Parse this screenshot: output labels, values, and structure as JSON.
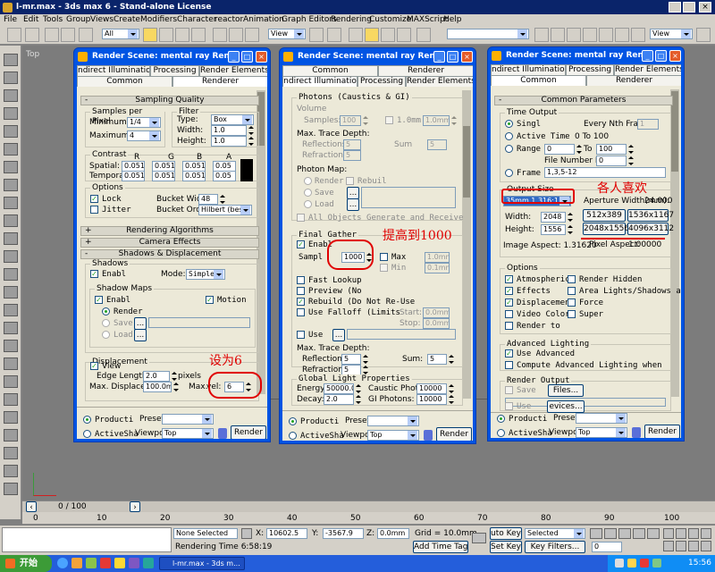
{
  "app": {
    "title": "l-mr.max - 3ds max 6 - Stand-alone License",
    "menu": [
      "File",
      "Edit",
      "Tools",
      "Group",
      "Views",
      "Create",
      "Modifiers",
      "Character",
      "reactor",
      "Animation",
      "Graph Editors",
      "Rendering",
      "Customize",
      "MAXScript",
      "Help"
    ],
    "toolbar": {
      "selection_filter": "All",
      "ref_coord": "View",
      "named_sel": "View"
    },
    "viewport_label": "Top"
  },
  "dialog1": {
    "title": "Render Scene: mental ray Ren...",
    "tabs_row1": [
      "ndirect Illumination",
      "Processing",
      "Render Elements"
    ],
    "tabs_row2": [
      "Common",
      "Renderer"
    ],
    "sampling": {
      "rollout": "Sampling Quality",
      "spp_group": "Samples per Pixel",
      "minimum_label": "Minimum:",
      "minimum": "1/4",
      "maximum_label": "Maximum:",
      "maximum": "4",
      "filter_group": "Filter",
      "type_label": "Type:",
      "type": "Box",
      "width_label": "Width:",
      "width": "1.0",
      "height_label": "Height:",
      "height": "1.0",
      "contrast_group": "Contrast",
      "r": "R",
      "g": "G",
      "b": "B",
      "a": "A",
      "spatial_label": "Spatial:",
      "spatial": [
        "0.051",
        "0.051",
        "0.051",
        "0.05"
      ],
      "temporal_label": "Temporal:",
      "temporal": [
        "0.051",
        "0.051",
        "0.051",
        "0.05"
      ],
      "options_group": "Options",
      "lock": "Lock",
      "jitter": "Jitter",
      "bucket_width_label": "Bucket Width:",
      "bucket_width": "48",
      "bucket_order_label": "Bucket Order:",
      "bucket_order": "Hilbert (best)"
    },
    "rollouts": [
      "Rendering Algorithms",
      "Camera Effects",
      "Shadows & Displacement"
    ],
    "shadows": {
      "group": "Shadows",
      "enable": "Enabl",
      "mode_label": "Mode:",
      "mode": "Simple"
    },
    "shadow_maps": {
      "group": "Shadow Maps",
      "enable": "Enabl",
      "motion": "Motion",
      "render": "Render",
      "save": "Save",
      "load": "Load",
      "browse": "..."
    },
    "displacement": {
      "group": "Displacement",
      "view": "View",
      "edge_length_label": "Edge Length:",
      "edge_length": "2.0",
      "edge_unit": "pixels",
      "max_displace_label": "Max. Displace:",
      "max_displace": "100.0mm",
      "max_level_label": "Max.",
      "max_level_tail": "vel:",
      "max_level": "6"
    },
    "bottom": {
      "production": "Producti",
      "activeshade": "ActiveSha",
      "preset_label": "Preset:",
      "preset": "",
      "viewport_label": "Viewport:",
      "viewport": "Top",
      "render": "Render"
    },
    "annotation": "设为6"
  },
  "dialog2": {
    "title": "Render Scene: mental ray Ren...",
    "tabs_row1": [
      "Common",
      "Renderer"
    ],
    "tabs_row2": [
      "ndirect Illuminatio",
      "Processing",
      "Render Elements"
    ],
    "photons": {
      "group": "Photons (Caustics & GI)",
      "volume": "Volume",
      "samples_label": "Samples:",
      "samples": "100",
      "radius_label": "Radius",
      "radius": "1.0mm",
      "max_trace_label": "Max. Trace Depth:",
      "reflections_label": "Reflections:",
      "reflections": "5",
      "refractions_label": "Refractions:",
      "refractions": "5",
      "sum_label": "Sum",
      "sum": "5",
      "photon_map_label": "Photon Map:",
      "render": "Render",
      "rebuild": "Rebuil",
      "save": "Save",
      "load": "Load",
      "browse": "...",
      "all_objects": "All Objects Generate and Receive"
    },
    "final_gather": {
      "group": "Final Gather",
      "enable": "Enabl",
      "samples_label": "Sampl",
      "samples": "1000",
      "max_label": "Max",
      "max": "1.0mm",
      "min_label": "Min",
      "min": "0.1mm",
      "fast_lookup": "Fast Lookup",
      "preview": "Preview (No",
      "rebuild": "Rebuild (Do Not Re-Use",
      "use_falloff": "Use Falloff (Limits",
      "start_label": "Start:",
      "start": "0.0mm",
      "stop_label": "Stop:",
      "stop": "0.0mm",
      "use": "Use",
      "browse": "...",
      "max_trace_label": "Max. Trace Depth:",
      "reflections_label": "Reflections:",
      "reflections": "5",
      "refractions_label": "Refractions:",
      "refractions": "5",
      "sum_label": "Sum:",
      "sum": "5"
    },
    "global_light": {
      "group": "Global Light Properties",
      "energy_label": "Energy:",
      "energy": "50000.0",
      "decay_label": "Decay:",
      "decay": "2.0",
      "caustic_label": "Caustic Photons:",
      "caustic": "10000",
      "gi_label": "GI Photons:",
      "gi": "10000"
    },
    "bottom": {
      "production": "Producti",
      "activeshade": "ActiveSha",
      "preset_label": "Preset:",
      "preset": "",
      "viewport_label": "Viewport:",
      "viewport": "Top",
      "render": "Render"
    },
    "annotation": "提高到1000"
  },
  "dialog3": {
    "title": "Render Scene: mental ray Ren...",
    "tabs_row1": [
      "ndirect Illumination",
      "Processing",
      "Render Elements"
    ],
    "tabs_row2": [
      "Common",
      "Renderer"
    ],
    "rollout": "Common Parameters",
    "time_output": {
      "group": "Time Output",
      "single": "Singl",
      "every_nth_label": "Every Nth Frame:",
      "every_nth": "1",
      "active_time": "Active Time",
      "active_range": "0 To 100",
      "range": "Range",
      "range_from": "0",
      "range_to_label": "To",
      "range_to": "100",
      "file_number_label": "File Number Base:",
      "file_number": "0",
      "frames": "Frame",
      "frames_value": "1,3,5-12"
    },
    "output_size": {
      "group": "Output Size",
      "preset": "35mm 1.316:1 Full Ap",
      "aperture_label": "Aperture Width(mm):",
      "aperture": "24.000",
      "width_label": "Width:",
      "width": "2048",
      "height_label": "Height:",
      "height": "1556",
      "presets": [
        "512x389",
        "1536x1167",
        "2048x1556",
        "4096x3112"
      ],
      "image_aspect": "Image Aspect: 1.31620",
      "pixel_aspect_label": "Pixel Aspect:",
      "pixel_aspect": "1.00000"
    },
    "options": {
      "group": "Options",
      "atmospherics": "Atmospherics",
      "render_hidden": "Render Hidden",
      "effects": "Effects",
      "area_lights": "Area Lights/Shadows as",
      "displacement": "Displacement",
      "force": "Force",
      "video_color": "Video Color",
      "super": "Super",
      "render_to": "Render to"
    },
    "advanced_lighting": {
      "group": "Advanced Lighting",
      "use_advanced": "Use Advanced",
      "compute": "Compute Advanced Lighting when"
    },
    "render_output": {
      "group": "Render Output",
      "save": "Save",
      "files": "Files...",
      "use": "Use",
      "devices": "evices..."
    },
    "bottom": {
      "production": "Producti",
      "activeshade": "ActiveSha",
      "preset_label": "Preset:",
      "preset": "",
      "viewport_label": "Viewport:",
      "viewport": "Top",
      "render": "Render"
    },
    "annotation": "各人喜欢"
  },
  "status": {
    "timeline": "0 / 100",
    "ticks": [
      "0",
      "10",
      "20",
      "30",
      "40",
      "50",
      "60",
      "70",
      "80",
      "90",
      "100"
    ],
    "none_selected": "None Selected",
    "rendering_time": "Rendering Time 6:58:19",
    "x_label": "X:",
    "x": "10602.5",
    "y_label": "Y:",
    "y": "-3567.9",
    "z_label": "Z:",
    "z": "0.0mm",
    "grid": "Grid = 10.0mm",
    "add_time_tag": "Add Time Tag",
    "auto_key": "uto Key",
    "set_key": "Set Key",
    "selected": "Selected",
    "key_filters": "Key Filters...",
    "frame": "0"
  },
  "taskbar": {
    "start": "开始",
    "item": "l-mr.max - 3ds m...",
    "clock": "15:56"
  }
}
